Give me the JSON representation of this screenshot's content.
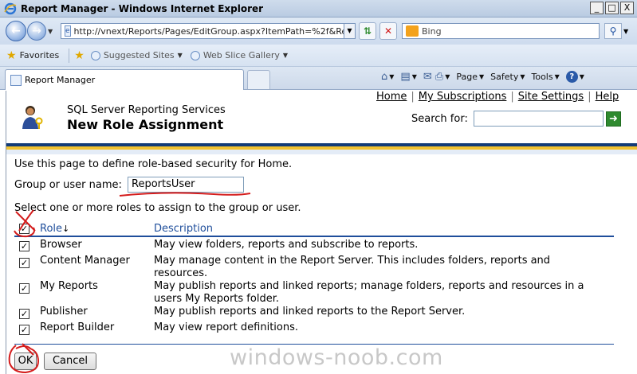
{
  "browser": {
    "title": "Report Manager - Windows Internet Explorer",
    "window_buttons": [
      "_",
      "□",
      "X"
    ],
    "address": "http://vnext/Reports/Pages/EditGroup.aspx?ItemPath=%2f&Rec",
    "search_placeholder": "Bing",
    "favorites_label": "Favorites",
    "favorites_items": [
      "Suggested Sites",
      "Web Slice Gallery"
    ],
    "tab_title": "Report Manager",
    "commands": [
      "Page",
      "Safety",
      "Tools"
    ]
  },
  "header": {
    "product": "SQL Server Reporting Services",
    "page_title": "New Role Assignment",
    "links": [
      "Home",
      "My Subscriptions",
      "Site Settings",
      "Help"
    ],
    "search_label": "Search for:",
    "search_value": ""
  },
  "form": {
    "intro": "Use this page to define role-based security for Home.",
    "group_label": "Group or user name:",
    "group_value": "ReportsUser",
    "select_text": "Select one or more roles to assign to the group or user.",
    "col_role": "Role",
    "col_role_sort": "↓",
    "col_desc": "Description",
    "roles": [
      {
        "name": "Browser",
        "desc": "May view folders, reports and subscribe to reports.",
        "checked": true
      },
      {
        "name": "Content Manager",
        "desc": "May manage content in the Report Server.  This includes folders, reports and resources.",
        "checked": true
      },
      {
        "name": "My Reports",
        "desc": "May publish reports and linked reports; manage folders, reports and resources in a users My Reports folder.",
        "checked": true
      },
      {
        "name": "Publisher",
        "desc": "May publish reports and linked reports to the Report Server.",
        "checked": true
      },
      {
        "name": "Report Builder",
        "desc": "May view report definitions.",
        "checked": true
      }
    ],
    "select_all_checked": true,
    "ok_label": "OK",
    "cancel_label": "Cancel"
  },
  "watermark": "windows-noob.com",
  "annotation_color": "#d41c1c"
}
